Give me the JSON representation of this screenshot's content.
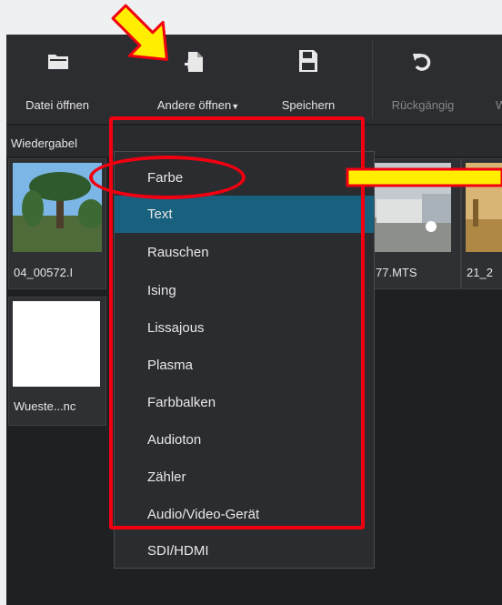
{
  "toolbar": {
    "open_file": "Datei öffnen",
    "open_other": "Andere öffnen",
    "save": "Speichern",
    "undo": "Rückgängig"
  },
  "tab": {
    "label": "Wiedergabel"
  },
  "clips": [
    {
      "name": "04_00572.I"
    },
    {
      "name": "77.MTS"
    },
    {
      "name": "21_2"
    },
    {
      "name": "Wueste...nc"
    }
  ],
  "menu": {
    "items": [
      "Farbe",
      "Text",
      "Rauschen",
      "Ising",
      "Lissajous",
      "Plasma",
      "Farbbalken",
      "Audioton",
      "Zähler",
      "Audio/Video-Gerät",
      "SDI/HDMI"
    ],
    "selected": "Text"
  },
  "colors": {
    "accent": "#17607e",
    "highlight_red": "#f00010",
    "arrow_yellow": "#ffee00"
  }
}
